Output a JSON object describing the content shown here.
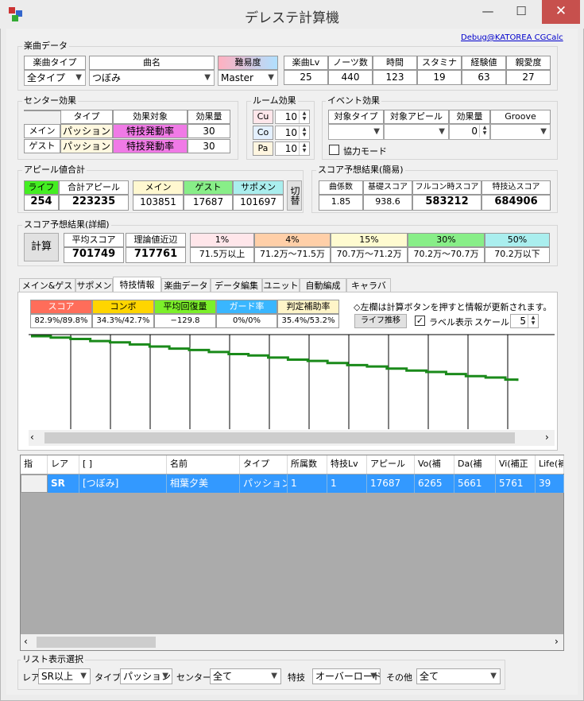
{
  "app": {
    "title": "デレステ計算機",
    "minimize": "—",
    "maximize": "☐",
    "close": "✕",
    "link": "Debug@KATOREA CGCalc"
  },
  "song": {
    "group": "楽曲データ",
    "type_label": "楽曲タイプ",
    "type_value": "全タイプ",
    "name_label": "曲名",
    "name_value": "つぼみ",
    "diff_label": "難易度",
    "diff_value": "Master",
    "stats_headers": [
      "楽曲Lv",
      "ノーツ数",
      "時間",
      "スタミナ",
      "経験値",
      "親愛度"
    ],
    "stats_values": [
      "25",
      "440",
      "123",
      "19",
      "63",
      "27"
    ]
  },
  "center": {
    "group": "センター効果",
    "headers": [
      "タイプ",
      "効果対象",
      "効果量"
    ],
    "rows": [
      {
        "label": "メイン",
        "type": "パッション",
        "target": "特技発動率",
        "amount": "30"
      },
      {
        "label": "ゲスト",
        "type": "パッション",
        "target": "特技発動率",
        "amount": "30"
      }
    ]
  },
  "room": {
    "group": "ルーム効果",
    "items": [
      {
        "label": "Cu",
        "value": "10"
      },
      {
        "label": "Co",
        "value": "10"
      },
      {
        "label": "Pa",
        "value": "10"
      }
    ]
  },
  "event": {
    "group": "イベント効果",
    "headers": [
      "対象タイプ",
      "対象アピール",
      "効果量",
      "Groove"
    ],
    "amount": "0",
    "checkbox": "協力モード"
  },
  "appeal": {
    "group": "アピール値合計",
    "life_label": "ライフ",
    "life": "254",
    "total_label": "合計アピール",
    "total": "223235",
    "main_label": "メイン",
    "main": "103851",
    "guest_label": "ゲスト",
    "guest": "17687",
    "support_label": "サポメン",
    "support": "101697",
    "switch": "切替"
  },
  "simple": {
    "group": "スコア予想結果(簡易)",
    "headers": [
      "曲係数",
      "基礎スコア",
      "フルコン時スコア",
      "特技込スコア"
    ],
    "values": [
      "1.85",
      "938.6",
      "583212",
      "684906"
    ]
  },
  "detail": {
    "group": "スコア予想結果(詳細)",
    "calc": "計算",
    "avg_label": "平均スコア",
    "avg": "701749",
    "near_label": "理論値近辺",
    "near": "717761",
    "pct_headers": [
      "1%",
      "4%",
      "15%",
      "30%",
      "50%"
    ],
    "pct_values": [
      "71.5万以上",
      "71.2万〜71.5万",
      "70.7万〜71.2万",
      "70.2万〜70.7万",
      "70.2万以下"
    ]
  },
  "tabs": [
    "メイン&ゲスト",
    "サポメン",
    "特技情報",
    "楽曲データ",
    "データ編集",
    "ユニット",
    "自動編成",
    "キャラバン"
  ],
  "skill": {
    "headers": [
      "スコア",
      "コンボ",
      "平均回復量",
      "ガード率",
      "判定補助率"
    ],
    "values": [
      "82.9%/89.8%",
      "34.3%/42.7%",
      "−129.8",
      "0%/0%",
      "35.4%/53.2%"
    ],
    "note": "◇左欄は計算ボタンを押すと情報が更新されます。",
    "life_btn": "ライフ推移",
    "label_check": "ラベル表示",
    "scale_label": "スケール",
    "scale_value": "5"
  },
  "chart_data": {
    "type": "line",
    "x": [
      0,
      5,
      10,
      15,
      20,
      25,
      30,
      35,
      40,
      45,
      50,
      55,
      60,
      65,
      70,
      75,
      80,
      85,
      90,
      95,
      100,
      105,
      110,
      115,
      120,
      123
    ],
    "values": [
      254,
      252,
      250,
      247,
      245,
      242,
      239,
      236,
      234,
      231,
      228,
      226,
      223,
      220,
      218,
      215,
      212,
      210,
      207,
      204,
      202,
      199,
      196,
      194,
      191,
      189
    ]
  },
  "list": {
    "headers": [
      "指",
      "レア",
      "[ ]",
      "名前",
      "タイプ",
      "所属数",
      "特技Lv",
      "アピール",
      "Vo(補",
      "Da(補",
      "Vi(補正",
      "Life(補"
    ],
    "rows": [
      {
        "rarity": "SR",
        "title": "[つぼみ]",
        "name": "相葉夕美",
        "type": "パッション",
        "count": "1",
        "skill": "1",
        "appeal": "17687",
        "vo": "6265",
        "da": "5661",
        "vi": "5761",
        "life": "39"
      }
    ]
  },
  "filter": {
    "group": "リスト表示選択",
    "rarity_label": "レア",
    "rarity": "SR以上",
    "type_label": "タイプ",
    "type": "パッション",
    "center_label": "センター",
    "center": "全て",
    "skill_label": "特技",
    "skill": "オーバーロード",
    "other_label": "その他",
    "other": "全て"
  },
  "colors": {
    "score": "#ff6d5a",
    "combo": "#ffd500",
    "recover": "#7cf02a",
    "guard": "#39b6ff",
    "judge": "#fff5c8",
    "line": "#1a8a1a",
    "select": "#3399ff"
  }
}
